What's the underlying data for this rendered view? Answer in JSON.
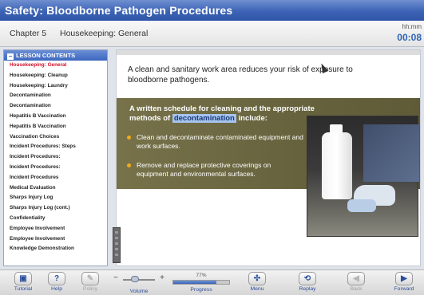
{
  "app": {
    "title": "Safety: Bloodborne Pathogen Procedures"
  },
  "chapter": {
    "label": "Chapter 5",
    "section": "Housekeeping: General"
  },
  "timer": {
    "label": "hh:mm",
    "value": "00:08"
  },
  "sidebar": {
    "header": "LESSON CONTENTS",
    "items": [
      {
        "label": "Housekeeping: General",
        "active": true
      },
      {
        "label": "Housekeeping: Cleanup"
      },
      {
        "label": "Housekeeping: Laundry"
      },
      {
        "label": "Decontamination"
      },
      {
        "label": "Decontamination"
      },
      {
        "label": "Hepatitis B Vaccination"
      },
      {
        "label": "Hepatitis B Vaccination"
      },
      {
        "label": "Vaccination Choices"
      },
      {
        "label": "Incident Procedures: Steps"
      },
      {
        "label": "Incident Procedures:"
      },
      {
        "label": "Incident Procedures:"
      },
      {
        "label": "Incident Procedures"
      },
      {
        "label": "Medical Evaluation"
      },
      {
        "label": "Sharps Injury Log"
      },
      {
        "label": "Sharps Injury Log (cont.)"
      },
      {
        "label": "Confidentiality"
      },
      {
        "label": "Employee Involvement"
      },
      {
        "label": "Employee Involvement"
      },
      {
        "label": "Knowledge Demonstration"
      }
    ]
  },
  "content": {
    "intro": "A clean and sanitary work area reduces your risk of exposure to bloodborne pathogens.",
    "heading_pre": "A written schedule for cleaning and the appropriate methods of ",
    "heading_highlight": "decontamination",
    "heading_post": " include:",
    "bullets": [
      "Clean and decontaminate contaminated equipment and work surfaces.",
      "Remove and replace protective coverings on equipment and environmental surfaces."
    ]
  },
  "footer": {
    "tutorial": "Tutorial",
    "help": "Help",
    "policy": "Policy",
    "volume": "Volume",
    "progress_pct": "77%",
    "progress_value": 0.77,
    "progress": "Progress",
    "menu": "Menu",
    "replay": "Replay",
    "back": "Back",
    "forward": "Forward"
  },
  "colors": {
    "accent": "#3c63b5",
    "active_item": "#d0102a",
    "panel": "#6b673f",
    "bullet": "#f2a91d"
  }
}
